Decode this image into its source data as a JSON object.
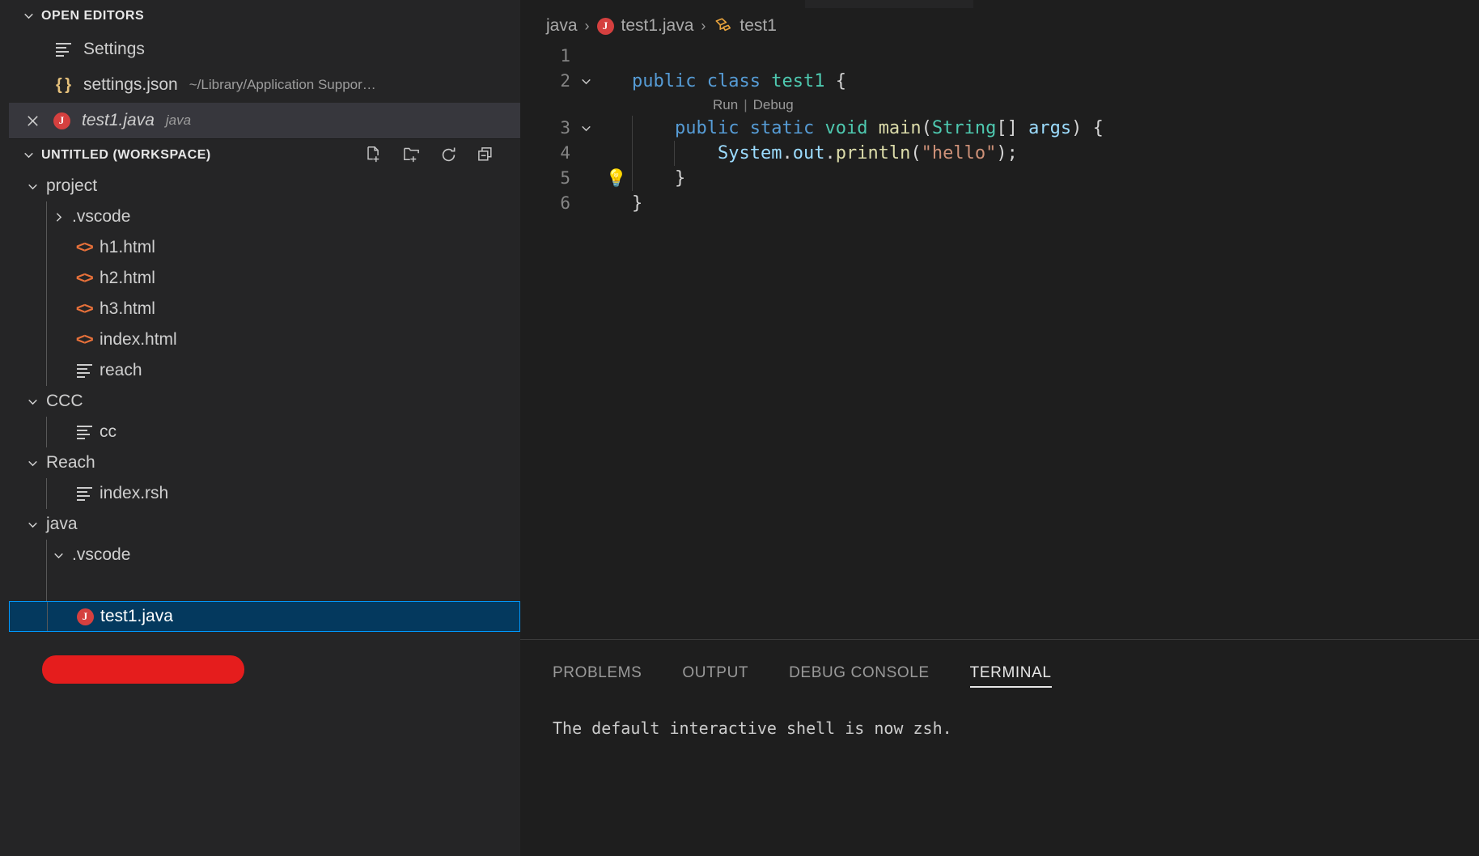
{
  "colors": {
    "accent": "#0097fb",
    "selection_bg": "#04395e",
    "redaction": "#e51d1d",
    "java_icon": "#d5403f",
    "html_icon": "#e8713a",
    "json_icon": "#e5c07b",
    "sidebar_bg": "#252526",
    "editor_bg": "#1e1e1e",
    "active_row_bg": "#37373d"
  },
  "sidebar": {
    "open_editors": {
      "title": "OPEN EDITORS",
      "twisty": "chevron-down-icon",
      "items": [
        {
          "name": "Settings",
          "icon": "lines-file-icon",
          "description": "",
          "active": false,
          "italic": false,
          "closable": false
        },
        {
          "name": "settings.json",
          "icon": "json-file-icon",
          "description": "~/Library/Application Suppor…",
          "active": false,
          "italic": false,
          "closable": false
        },
        {
          "name": "test1.java",
          "icon": "java-file-icon",
          "description": "java",
          "active": true,
          "italic": true,
          "closable": true
        }
      ]
    },
    "workspace": {
      "title": "UNTITLED (WORKSPACE)",
      "twisty": "chevron-down-icon",
      "actions": [
        {
          "name": "New File",
          "icon": "new-file-icon"
        },
        {
          "name": "New Folder",
          "icon": "new-folder-icon"
        },
        {
          "name": "Refresh Explorer",
          "icon": "refresh-icon"
        },
        {
          "name": "Collapse Folders in Explorer",
          "icon": "collapse-all-icon"
        }
      ],
      "tree": [
        {
          "label": "project",
          "depth": 0,
          "type": "folder",
          "state": "expanded",
          "icon": ""
        },
        {
          "label": ".vscode",
          "depth": 1,
          "type": "folder",
          "state": "collapsed",
          "icon": ""
        },
        {
          "label": "h1.html",
          "depth": 1,
          "type": "file",
          "state": "",
          "icon": "html-file-icon"
        },
        {
          "label": "h2.html",
          "depth": 1,
          "type": "file",
          "state": "",
          "icon": "html-file-icon"
        },
        {
          "label": "h3.html",
          "depth": 1,
          "type": "file",
          "state": "",
          "icon": "html-file-icon"
        },
        {
          "label": "index.html",
          "depth": 1,
          "type": "file",
          "state": "",
          "icon": "html-file-icon"
        },
        {
          "label": "reach",
          "depth": 1,
          "type": "file",
          "state": "",
          "icon": "lines-file-icon"
        },
        {
          "label": "CCC",
          "depth": 0,
          "type": "folder",
          "state": "expanded",
          "icon": ""
        },
        {
          "label": "cc",
          "depth": 1,
          "type": "file",
          "state": "",
          "icon": "lines-file-icon"
        },
        {
          "label": "Reach",
          "depth": 0,
          "type": "folder",
          "state": "expanded",
          "icon": ""
        },
        {
          "label": "index.rsh",
          "depth": 1,
          "type": "file",
          "state": "",
          "icon": "lines-file-icon"
        },
        {
          "label": "java",
          "depth": 0,
          "type": "folder",
          "state": "expanded",
          "icon": ""
        },
        {
          "label": ".vscode",
          "depth": 1,
          "type": "folder",
          "state": "expanded",
          "icon": ""
        },
        {
          "label": "",
          "depth": 1,
          "type": "redacted",
          "state": "",
          "icon": ""
        },
        {
          "label": "test1.java",
          "depth": 1,
          "type": "file",
          "state": "",
          "icon": "java-file-icon",
          "selected": true
        }
      ]
    }
  },
  "editor": {
    "breadcrumb": [
      {
        "label": "java",
        "icon": ""
      },
      {
        "label": "test1.java",
        "icon": "java-file-icon"
      },
      {
        "label": "test1",
        "icon": "class-symbol-icon"
      }
    ],
    "breadcrumb_separator": "›",
    "codelens": {
      "run": "Run",
      "separator": "|",
      "debug": "Debug"
    },
    "lightbulb_line": 5,
    "lines": [
      {
        "num": "1",
        "fold": "",
        "tokens": []
      },
      {
        "num": "2",
        "fold": "down",
        "tokens": [
          {
            "t": "public",
            "c": "t-kw"
          },
          {
            "t": " ",
            "c": "t-plain"
          },
          {
            "t": "class",
            "c": "t-kw"
          },
          {
            "t": " ",
            "c": "t-plain"
          },
          {
            "t": "test1",
            "c": "t-type"
          },
          {
            "t": " {",
            "c": "t-plain"
          }
        ]
      },
      {
        "num": "3",
        "fold": "down",
        "tokens": [
          {
            "t": "    ",
            "c": "t-plain"
          },
          {
            "t": "public",
            "c": "t-kw"
          },
          {
            "t": " ",
            "c": "t-plain"
          },
          {
            "t": "static",
            "c": "t-kw"
          },
          {
            "t": " ",
            "c": "t-plain"
          },
          {
            "t": "void",
            "c": "t-type"
          },
          {
            "t": " ",
            "c": "t-plain"
          },
          {
            "t": "main",
            "c": "t-fn"
          },
          {
            "t": "(",
            "c": "t-plain"
          },
          {
            "t": "String",
            "c": "t-type"
          },
          {
            "t": "[] ",
            "c": "t-plain"
          },
          {
            "t": "args",
            "c": "t-var"
          },
          {
            "t": ") {",
            "c": "t-plain"
          }
        ]
      },
      {
        "num": "4",
        "fold": "",
        "tokens": [
          {
            "t": "        ",
            "c": "t-plain"
          },
          {
            "t": "System",
            "c": "t-var"
          },
          {
            "t": ".",
            "c": "t-plain"
          },
          {
            "t": "out",
            "c": "t-var"
          },
          {
            "t": ".",
            "c": "t-plain"
          },
          {
            "t": "println",
            "c": "t-fn"
          },
          {
            "t": "(",
            "c": "t-plain"
          },
          {
            "t": "\"hello\"",
            "c": "t-str"
          },
          {
            "t": ");",
            "c": "t-plain"
          }
        ]
      },
      {
        "num": "5",
        "fold": "",
        "tokens": [
          {
            "t": "    }",
            "c": "t-plain"
          }
        ]
      },
      {
        "num": "6",
        "fold": "",
        "tokens": [
          {
            "t": "}",
            "c": "t-plain"
          }
        ]
      }
    ]
  },
  "panel": {
    "tabs": [
      {
        "label": "PROBLEMS",
        "active": false
      },
      {
        "label": "OUTPUT",
        "active": false
      },
      {
        "label": "DEBUG CONSOLE",
        "active": false
      },
      {
        "label": "TERMINAL",
        "active": true
      }
    ],
    "terminal_text": "The default interactive shell is now zsh."
  }
}
